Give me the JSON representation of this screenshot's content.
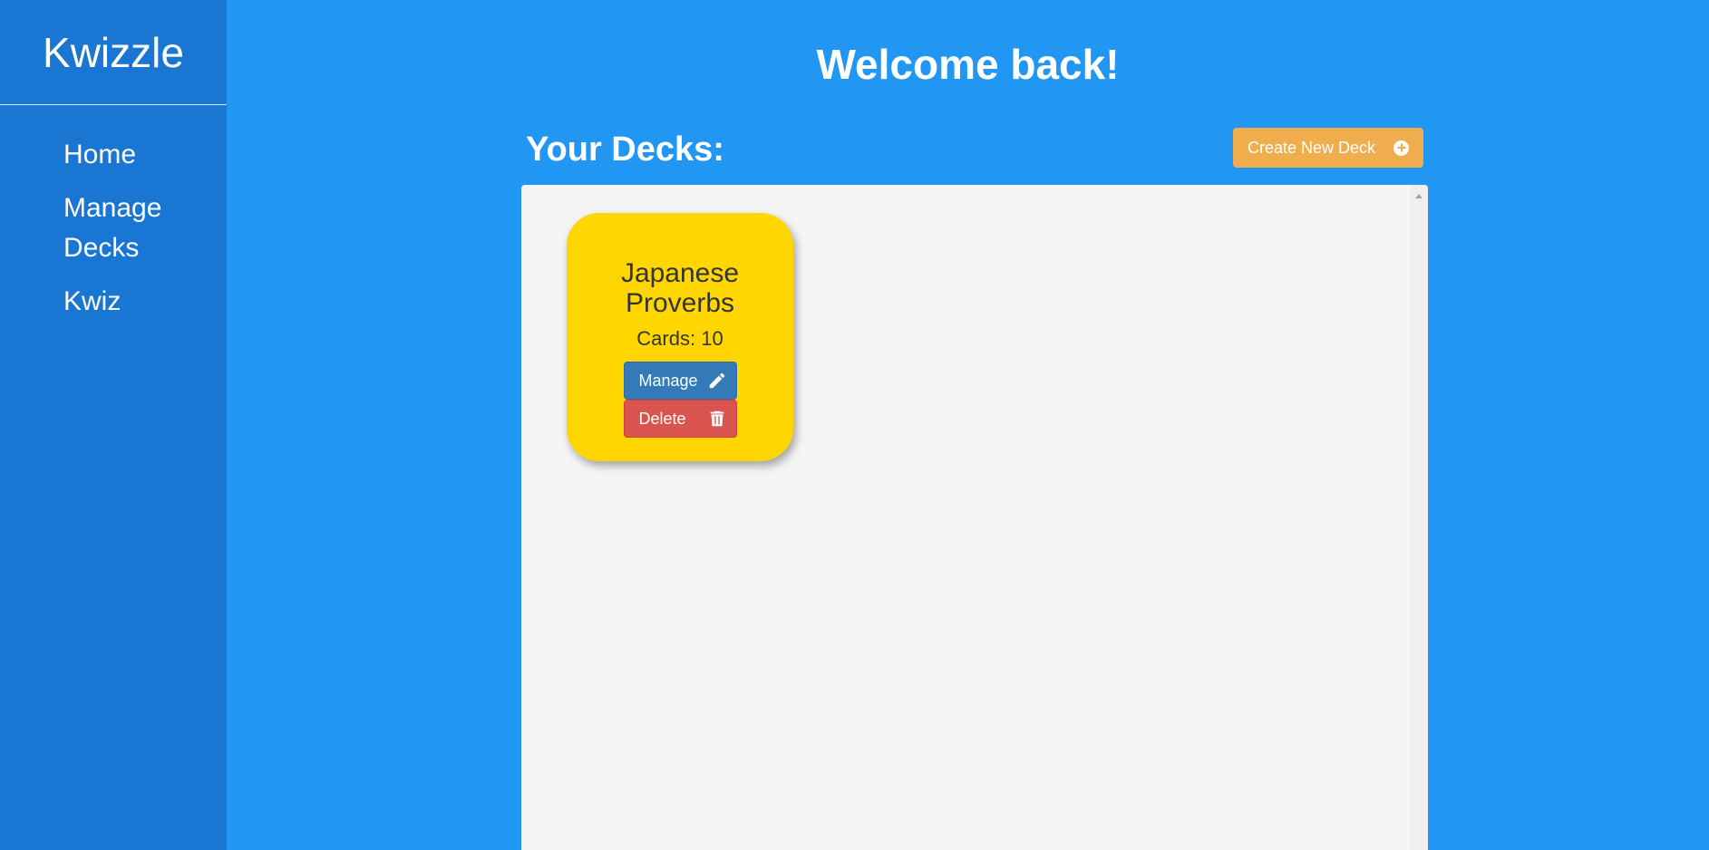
{
  "sidebar": {
    "brand": "Kwizzle",
    "items": [
      {
        "label": "Home"
      },
      {
        "label": "Manage Decks"
      },
      {
        "label": "Kwiz"
      }
    ]
  },
  "main": {
    "welcome": "Welcome back!",
    "decks_heading": "Your Decks:",
    "create_button": {
      "label": "Create New Deck",
      "icon": "plus-circle-icon"
    },
    "decks": [
      {
        "title": "Japanese Proverbs",
        "cards_text": "Cards: 10",
        "manage_label": "Manage",
        "manage_icon": "pencil-icon",
        "delete_label": "Delete",
        "delete_icon": "trash-icon"
      }
    ]
  },
  "colors": {
    "background": "#2196f3",
    "sidebar": "#1976d2",
    "create_button": "#f0ad4e",
    "deck_card": "#ffd600",
    "manage_button": "#337ab7",
    "delete_button": "#d9534f",
    "panel": "#f5f5f5"
  }
}
